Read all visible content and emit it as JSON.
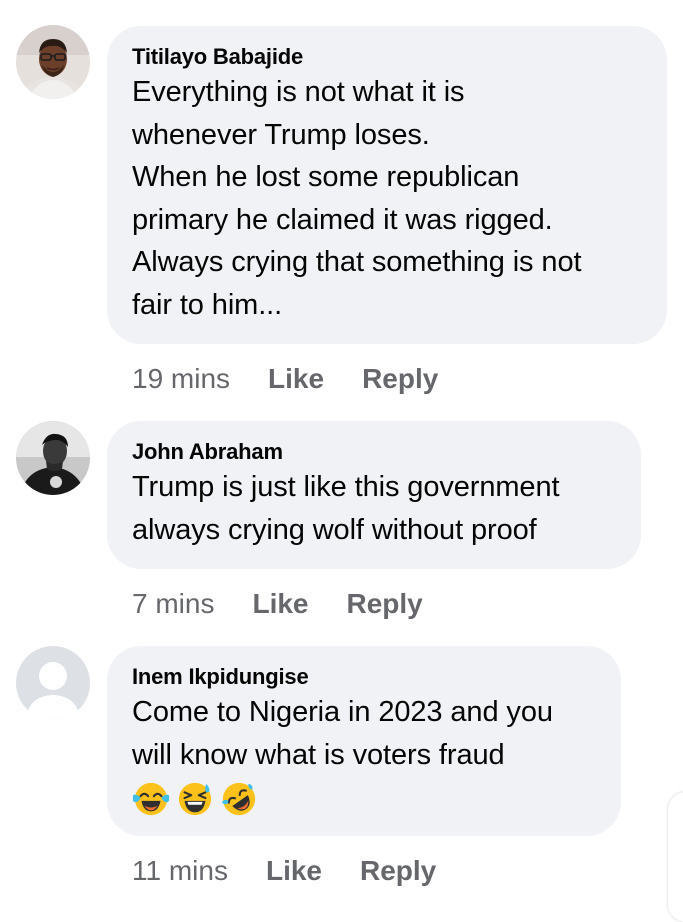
{
  "comments": [
    {
      "author": "Titilayo Babajide",
      "text_lines": [
        "Everything is not what it is",
        "whenever Trump loses.",
        "When he lost some republican",
        "primary he claimed it was rigged.",
        "Always crying that something is not",
        "fair to him..."
      ],
      "time": "19 mins",
      "like_label": "Like",
      "reply_label": "Reply",
      "avatar": "profile-photo-man-glasses"
    },
    {
      "author": "John Abraham",
      "text_lines": [
        "Trump is just like this government",
        "always crying wolf without proof"
      ],
      "time": "7 mins",
      "like_label": "Like",
      "reply_label": "Reply",
      "avatar": "profile-photo-man-bw"
    },
    {
      "author": "Inem Ikpidungise",
      "text_lines": [
        "Come to Nigeria in 2023 and you",
        "will know what is voters fraud"
      ],
      "emojis": [
        "face-with-tears-of-joy",
        "grinning-squinting-sweat-face",
        "rolling-on-floor-laughing"
      ],
      "time": "11 mins",
      "like_label": "Like",
      "reply_label": "Reply",
      "avatar": "default-avatar-placeholder"
    }
  ],
  "colors": {
    "bubble": "#f0f2f5",
    "text": "#050505",
    "meta": "#65676b"
  }
}
